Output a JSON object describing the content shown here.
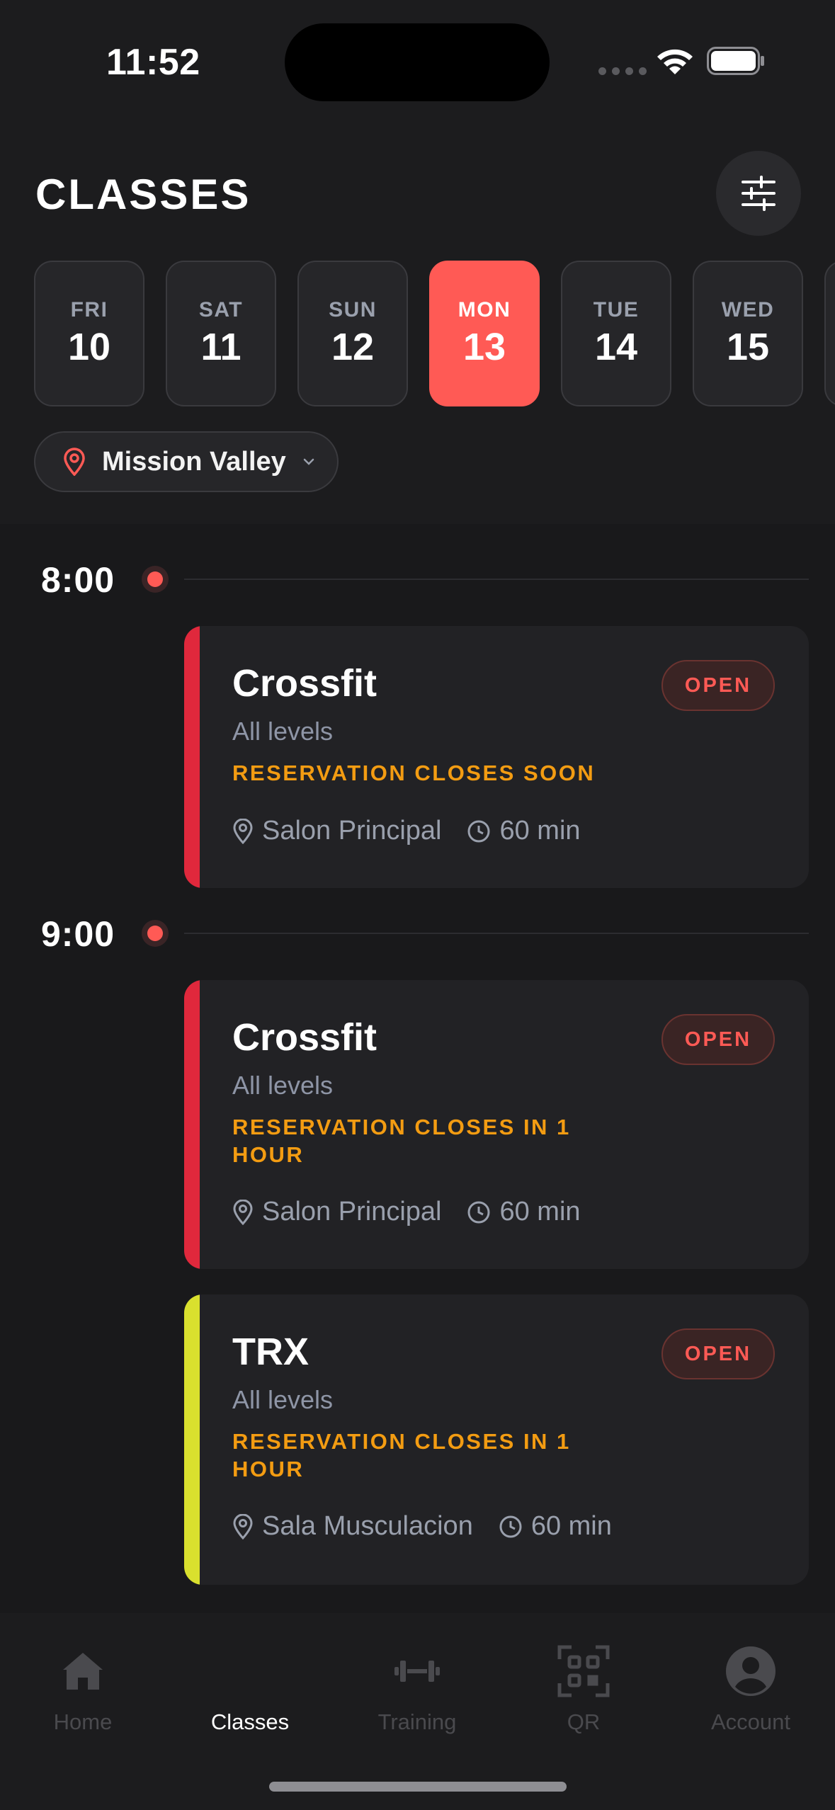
{
  "status_bar": {
    "time": "11:52"
  },
  "header": {
    "title": "CLASSES",
    "filter_icon": "sliders-icon"
  },
  "dates": [
    {
      "dow": "FRI",
      "day": "10",
      "selected": false
    },
    {
      "dow": "SAT",
      "day": "11",
      "selected": false
    },
    {
      "dow": "SUN",
      "day": "12",
      "selected": false
    },
    {
      "dow": "MON",
      "day": "13",
      "selected": true
    },
    {
      "dow": "TUE",
      "day": "14",
      "selected": false
    },
    {
      "dow": "WED",
      "day": "15",
      "selected": false
    }
  ],
  "location": {
    "label": "Mission Valley",
    "icon": "map-pin-icon"
  },
  "schedule": [
    {
      "time": "8:00",
      "classes": [
        {
          "name": "Crossfit",
          "level": "All levels",
          "warning": "RESERVATION CLOSES SOON",
          "status": "OPEN",
          "room": "Salon Principal",
          "duration": "60 min",
          "accent": "#e0283c"
        }
      ]
    },
    {
      "time": "9:00",
      "classes": [
        {
          "name": "Crossfit",
          "level": "All levels",
          "warning": "RESERVATION CLOSES IN 1 HOUR",
          "status": "OPEN",
          "room": "Salon Principal",
          "duration": "60 min",
          "accent": "#e0283c"
        },
        {
          "name": "TRX",
          "level": "All levels",
          "warning": "RESERVATION CLOSES IN 1 HOUR",
          "status": "OPEN",
          "room": "Sala Musculacion",
          "duration": "60 min",
          "accent": "#d9e02e"
        }
      ]
    }
  ],
  "tabs": [
    {
      "label": "Home",
      "icon": "home-icon",
      "active": false
    },
    {
      "label": "Classes",
      "icon": "calendar-icon",
      "active": true
    },
    {
      "label": "Training",
      "icon": "dumbbell-icon",
      "active": false
    },
    {
      "label": "QR",
      "icon": "qr-code-icon",
      "active": false
    },
    {
      "label": "Account",
      "icon": "user-icon",
      "active": false
    }
  ],
  "colors": {
    "accent": "#ff5a55",
    "warning": "#f39c12",
    "background": "#1c1c1e"
  }
}
